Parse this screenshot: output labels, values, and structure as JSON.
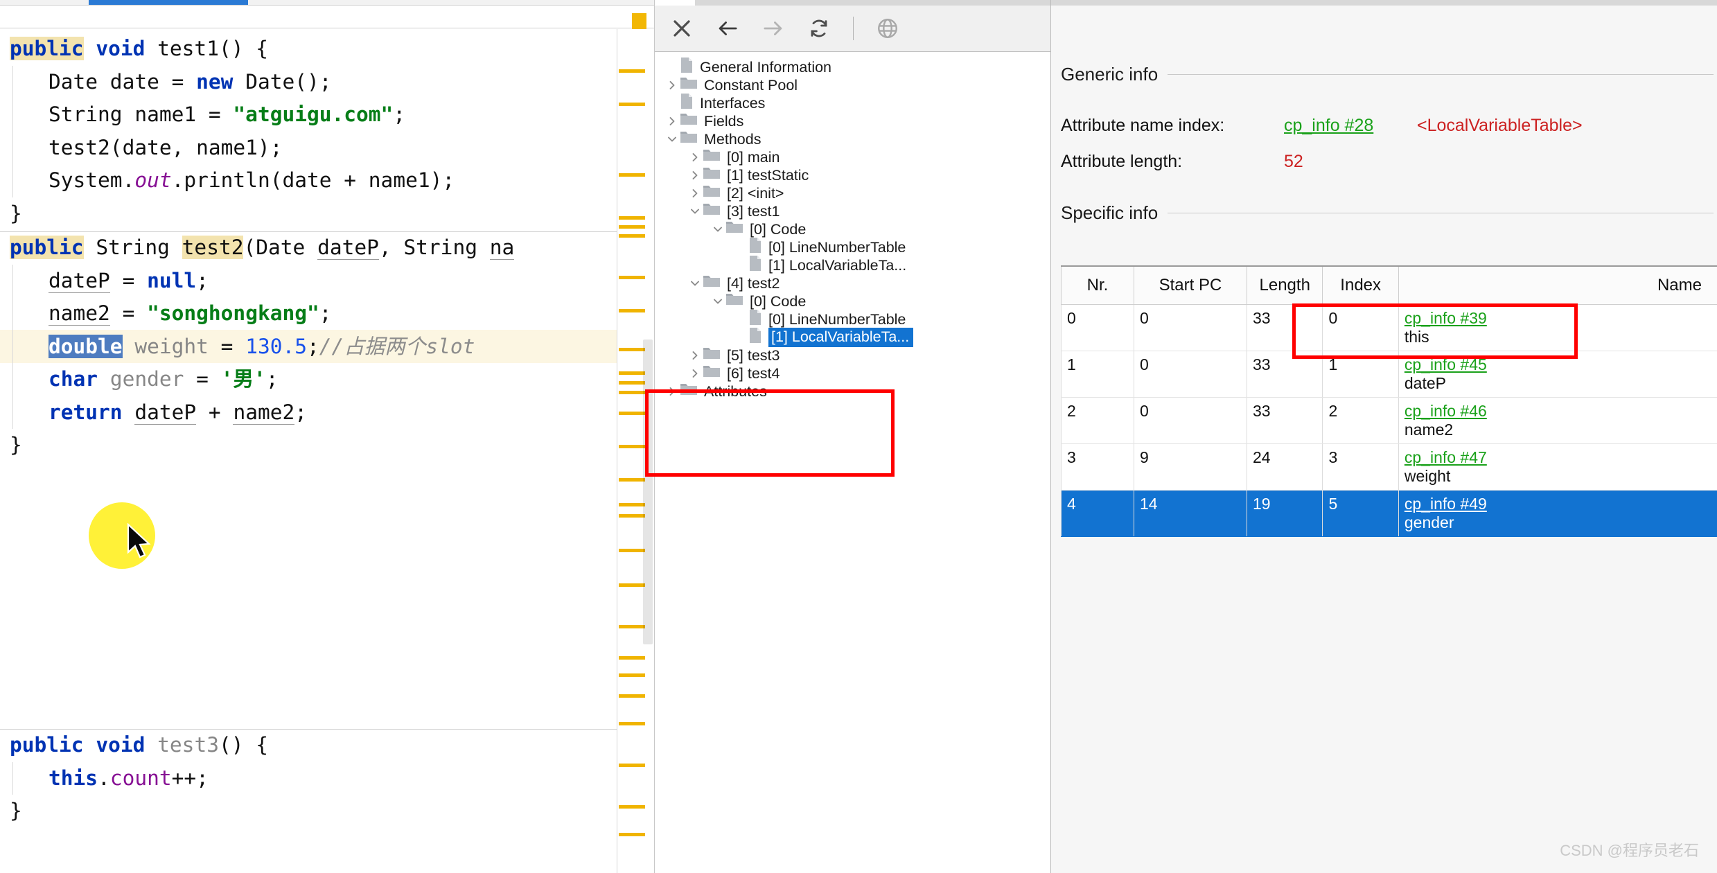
{
  "editor": {
    "blocks": [
      {
        "id": "method-test1",
        "lines": [
          [
            {
              "t": "public",
              "c": "kw-hl"
            },
            {
              "t": " ",
              "c": "plain"
            },
            {
              "t": "void",
              "c": "kw"
            },
            {
              "t": " test1() {",
              "c": "plain"
            }
          ],
          [
            {
              "t": "Date date = ",
              "c": "plain"
            },
            {
              "t": "new",
              "c": "kw"
            },
            {
              "t": " Date();",
              "c": "plain"
            }
          ],
          [
            {
              "t": "String name1 = ",
              "c": "plain"
            },
            {
              "t": "\"atguigu.com\"",
              "c": "str"
            },
            {
              "t": ";",
              "c": "plain"
            }
          ],
          [
            {
              "t": "test2(date, name1);",
              "c": "plain"
            }
          ],
          [
            {
              "t": "System.",
              "c": "plain"
            },
            {
              "t": "out",
              "c": "ital"
            },
            {
              "t": ".println(date + name1);",
              "c": "plain"
            }
          ],
          [
            {
              "t": "}",
              "c": "plain"
            }
          ]
        ]
      },
      {
        "id": "method-test2",
        "lines": [
          [
            {
              "t": "public",
              "c": "kw-hl"
            },
            {
              "t": " String ",
              "c": "plain"
            },
            {
              "t": "test2",
              "c": "id-hl"
            },
            {
              "t": "(Date ",
              "c": "plain"
            },
            {
              "t": "dateP",
              "c": "param"
            },
            {
              "t": ", String ",
              "c": "plain"
            },
            {
              "t": "na",
              "c": "param"
            }
          ],
          [
            {
              "t": "dateP",
              "c": "param"
            },
            {
              "t": " = ",
              "c": "plain"
            },
            {
              "t": "null",
              "c": "kw"
            },
            {
              "t": ";",
              "c": "plain"
            }
          ],
          [
            {
              "t": "name2",
              "c": "param"
            },
            {
              "t": " = ",
              "c": "plain"
            },
            {
              "t": "\"songhongkang\"",
              "c": "str"
            },
            {
              "t": ";",
              "c": "plain"
            }
          ],
          [
            {
              "t": "double",
              "c": "kw"
            },
            {
              "t": " ",
              "c": "plain"
            },
            {
              "t": "weight",
              "c": "grey"
            },
            {
              "t": " = ",
              "c": "plain"
            },
            {
              "t": "130.5",
              "c": "num"
            },
            {
              "t": ";",
              "c": "plain"
            },
            {
              "t": "//占据两个slot",
              "c": "cmt"
            }
          ],
          [
            {
              "t": "char",
              "c": "kw"
            },
            {
              "t": " ",
              "c": "plain"
            },
            {
              "t": "gender",
              "c": "grey"
            },
            {
              "t": " = ",
              "c": "plain"
            },
            {
              "t": "'男'",
              "c": "str"
            },
            {
              "t": ";",
              "c": "plain"
            }
          ],
          [
            {
              "t": "return",
              "c": "kw"
            },
            {
              "t": " ",
              "c": "plain"
            },
            {
              "t": "dateP",
              "c": "param"
            },
            {
              "t": " + ",
              "c": "plain"
            },
            {
              "t": "name2",
              "c": "param"
            },
            {
              "t": ";",
              "c": "plain"
            }
          ],
          [
            {
              "t": "}",
              "c": "plain"
            }
          ]
        ]
      },
      {
        "id": "method-test3",
        "lines": [
          [
            {
              "t": "public",
              "c": "kw"
            },
            {
              "t": " ",
              "c": "plain"
            },
            {
              "t": "void",
              "c": "kw"
            },
            {
              "t": " ",
              "c": "plain"
            },
            {
              "t": "test3",
              "c": "grey"
            },
            {
              "t": "() {",
              "c": "plain"
            }
          ],
          [
            {
              "t": "this",
              "c": "kw"
            },
            {
              "t": ".",
              "c": "plain"
            },
            {
              "t": "count",
              "c": "fld"
            },
            {
              "t": "++;",
              "c": "plain"
            }
          ],
          [
            {
              "t": "}",
              "c": "plain"
            }
          ]
        ]
      }
    ]
  },
  "tree": {
    "toolbar": [
      {
        "name": "close-icon",
        "label": "Close"
      },
      {
        "name": "back-arrow-icon",
        "label": "Back"
      },
      {
        "name": "forward-arrow-icon",
        "label": "Forward"
      },
      {
        "name": "reload-icon",
        "label": "Reload"
      },
      {
        "name": "browse-globe-icon",
        "label": "Browse"
      }
    ],
    "nodes": [
      {
        "label": "General Information",
        "depth": 0,
        "twisty": "",
        "icon": "file",
        "selected": false
      },
      {
        "label": "Constant Pool",
        "depth": 0,
        "twisty": "collapsed",
        "icon": "folder",
        "selected": false
      },
      {
        "label": "Interfaces",
        "depth": 0,
        "twisty": "",
        "icon": "file",
        "selected": false
      },
      {
        "label": "Fields",
        "depth": 0,
        "twisty": "collapsed",
        "icon": "folder",
        "selected": false
      },
      {
        "label": "Methods",
        "depth": 0,
        "twisty": "expanded",
        "icon": "folder",
        "selected": false
      },
      {
        "label": "[0] main",
        "depth": 1,
        "twisty": "collapsed",
        "icon": "folder",
        "selected": false
      },
      {
        "label": "[1] testStatic",
        "depth": 1,
        "twisty": "collapsed",
        "icon": "folder",
        "selected": false
      },
      {
        "label": "[2] <init>",
        "depth": 1,
        "twisty": "collapsed",
        "icon": "folder",
        "selected": false
      },
      {
        "label": "[3] test1",
        "depth": 1,
        "twisty": "expanded",
        "icon": "folder",
        "selected": false
      },
      {
        "label": "[0] Code",
        "depth": 2,
        "twisty": "expanded",
        "icon": "folder",
        "selected": false
      },
      {
        "label": "[0] LineNumberTable",
        "depth": 3,
        "twisty": "",
        "icon": "file",
        "selected": false
      },
      {
        "label": "[1] LocalVariableTa...",
        "depth": 3,
        "twisty": "",
        "icon": "file",
        "selected": false
      },
      {
        "label": "[4] test2",
        "depth": 1,
        "twisty": "expanded",
        "icon": "folder",
        "selected": false
      },
      {
        "label": "[0] Code",
        "depth": 2,
        "twisty": "expanded",
        "icon": "folder",
        "selected": false
      },
      {
        "label": "[0] LineNumberTable",
        "depth": 3,
        "twisty": "",
        "icon": "file",
        "selected": false
      },
      {
        "label": "[1] LocalVariableTa...",
        "depth": 3,
        "twisty": "",
        "icon": "file",
        "selected": true
      },
      {
        "label": "[5] test3",
        "depth": 1,
        "twisty": "collapsed",
        "icon": "folder",
        "selected": false
      },
      {
        "label": "[6] test4",
        "depth": 1,
        "twisty": "collapsed",
        "icon": "folder",
        "selected": false
      },
      {
        "label": "Attributes",
        "depth": 0,
        "twisty": "collapsed",
        "icon": "folder",
        "selected": false
      }
    ]
  },
  "detail": {
    "generic_section_title": "Generic info",
    "attribute_name_index_label": "Attribute name index:",
    "attribute_name_index_link": "cp_info #28",
    "attribute_name_index_value": "<LocalVariableTable>",
    "attribute_length_label": "Attribute length:",
    "attribute_length_value": "52",
    "specific_section_title": "Specific info",
    "table": {
      "headers": [
        "Nr.",
        "Start PC",
        "Length",
        "Index",
        "Name"
      ],
      "rows": [
        {
          "nr": "0",
          "start_pc": "0",
          "length": "33",
          "index": "0",
          "cp": "cp_info #39",
          "name": "this",
          "selected": false
        },
        {
          "nr": "1",
          "start_pc": "0",
          "length": "33",
          "index": "1",
          "cp": "cp_info #45",
          "name": "dateP",
          "selected": false
        },
        {
          "nr": "2",
          "start_pc": "0",
          "length": "33",
          "index": "2",
          "cp": "cp_info #46",
          "name": "name2",
          "selected": false
        },
        {
          "nr": "3",
          "start_pc": "9",
          "length": "24",
          "index": "3",
          "cp": "cp_info #47",
          "name": "weight",
          "selected": false
        },
        {
          "nr": "4",
          "start_pc": "14",
          "length": "19",
          "index": "5",
          "cp": "cp_info #49",
          "name": "gender",
          "selected": true
        }
      ]
    }
  },
  "watermark": "CSDN @程序员老石",
  "colors": {
    "accent_blue": "#1273d1",
    "tab_blue": "#2b7ad4",
    "annotation_red": "#ff0000",
    "link_green": "#1aa11a",
    "value_red": "#cc2222",
    "gutter_yellow": "#f0b400",
    "highlight_yellow": "#ffed00"
  }
}
